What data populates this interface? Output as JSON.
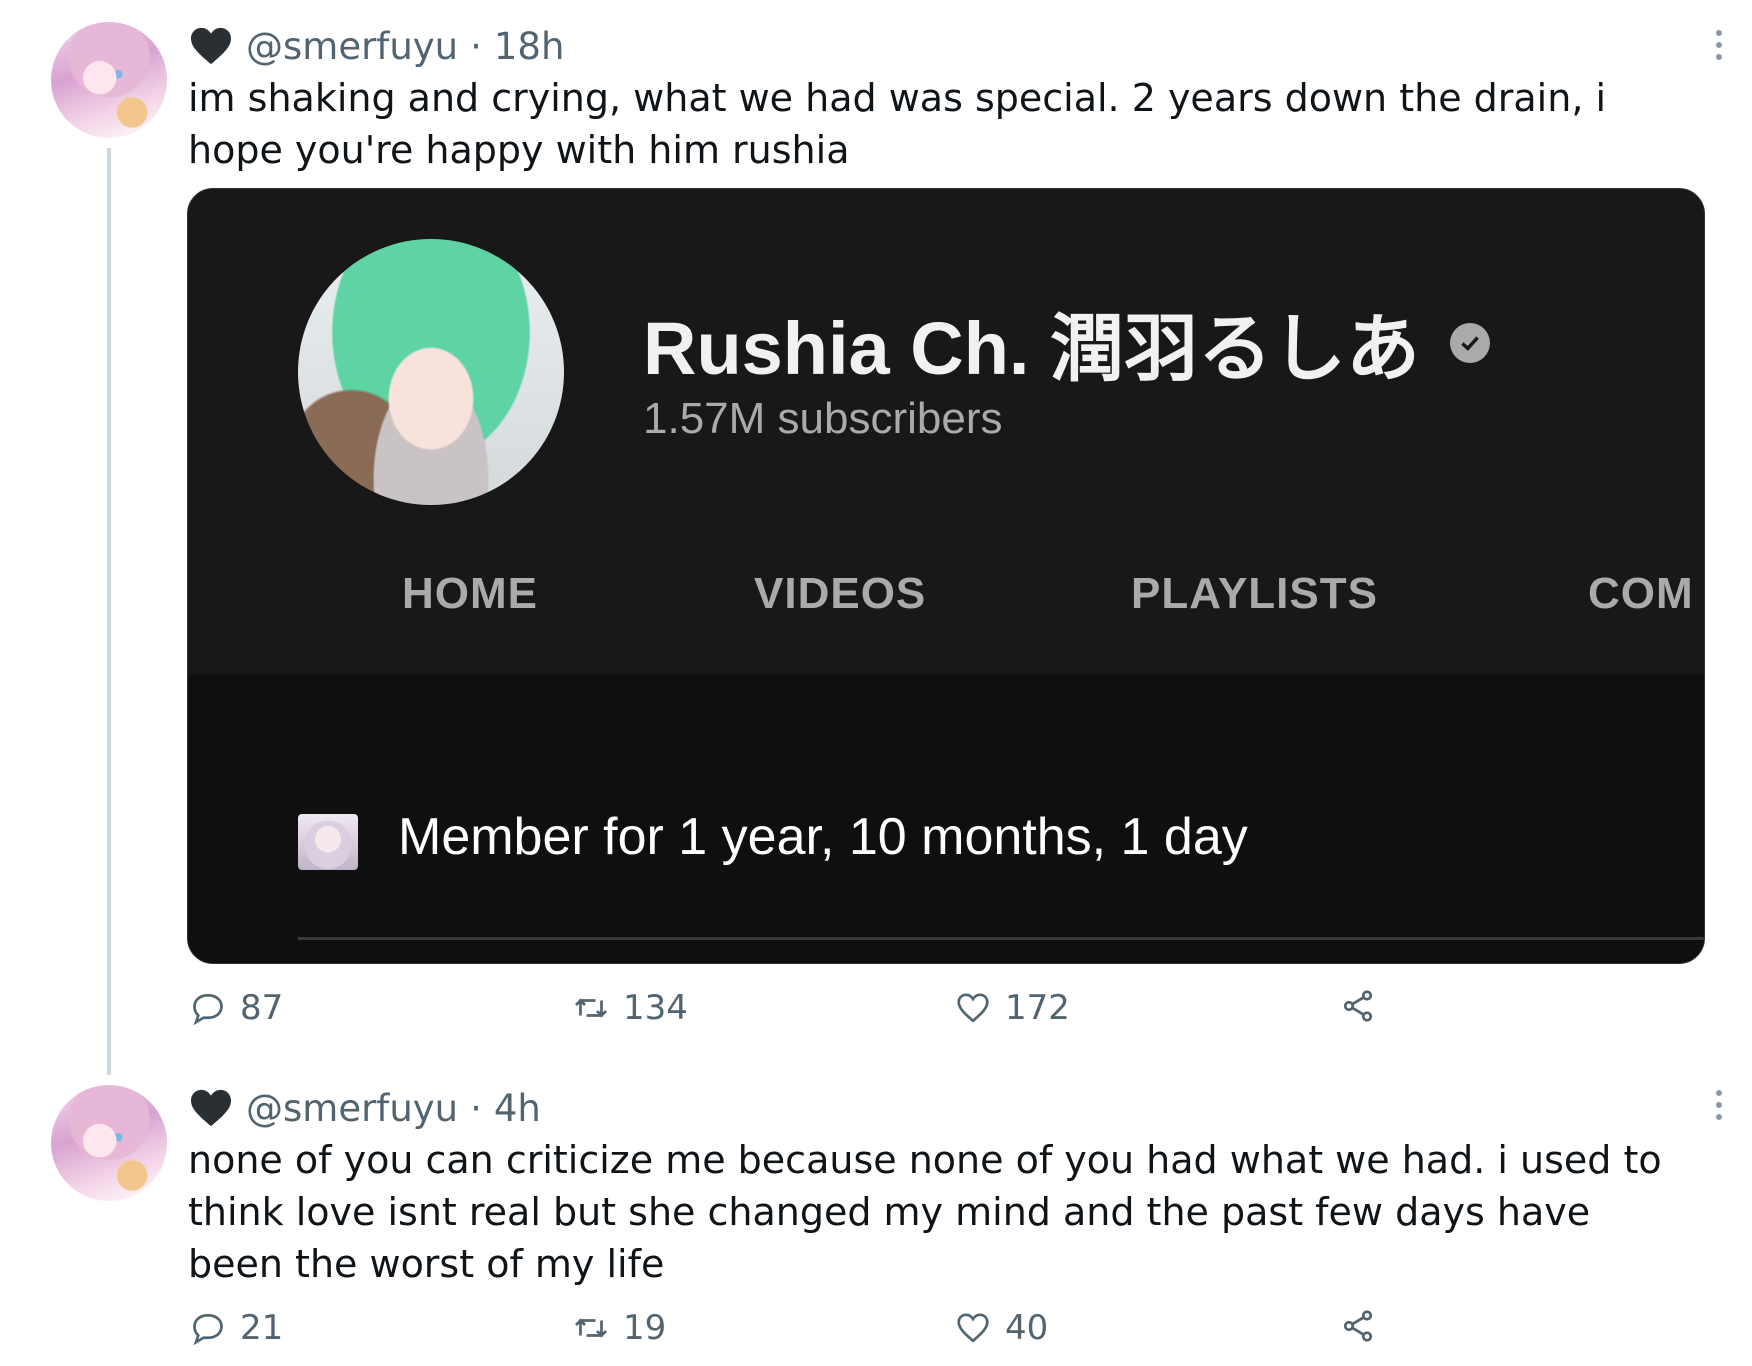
{
  "tweets": [
    {
      "handle": "@smerfuyu",
      "separator": "·",
      "time": "18h",
      "text": "im shaking and crying, what we had was special. 2 years down the drain, i hope you're happy with him rushia",
      "media": {
        "channel_name": "Rushia Ch. 潤羽るしあ",
        "subscribers": "1.57M subscribers",
        "tabs": [
          "HOME",
          "VIDEOS",
          "PLAYLISTS",
          "COM"
        ],
        "membership": "Member for 1 year, 10 months, 1 day"
      },
      "stats": {
        "replies": "87",
        "retweets": "134",
        "likes": "172"
      }
    },
    {
      "handle": "@smerfuyu",
      "separator": "·",
      "time": "4h",
      "text": "none of you can criticize me because none of you had what we had. i used to think love isnt real but she changed my mind and the past few days have been the worst of my life",
      "stats": {
        "replies": "21",
        "retweets": "19",
        "likes": "40"
      }
    }
  ],
  "icons": {
    "badge": "black-heart-icon",
    "more": "more-options-icon",
    "reply": "reply-icon",
    "retweet": "retweet-icon",
    "like": "heart-icon",
    "share": "share-icon",
    "verified": "verified-check-icon"
  },
  "colors": {
    "text": "#0f1419",
    "muted": "#536471",
    "thread_line": "#cfd9de",
    "media_bg": "#181818"
  }
}
